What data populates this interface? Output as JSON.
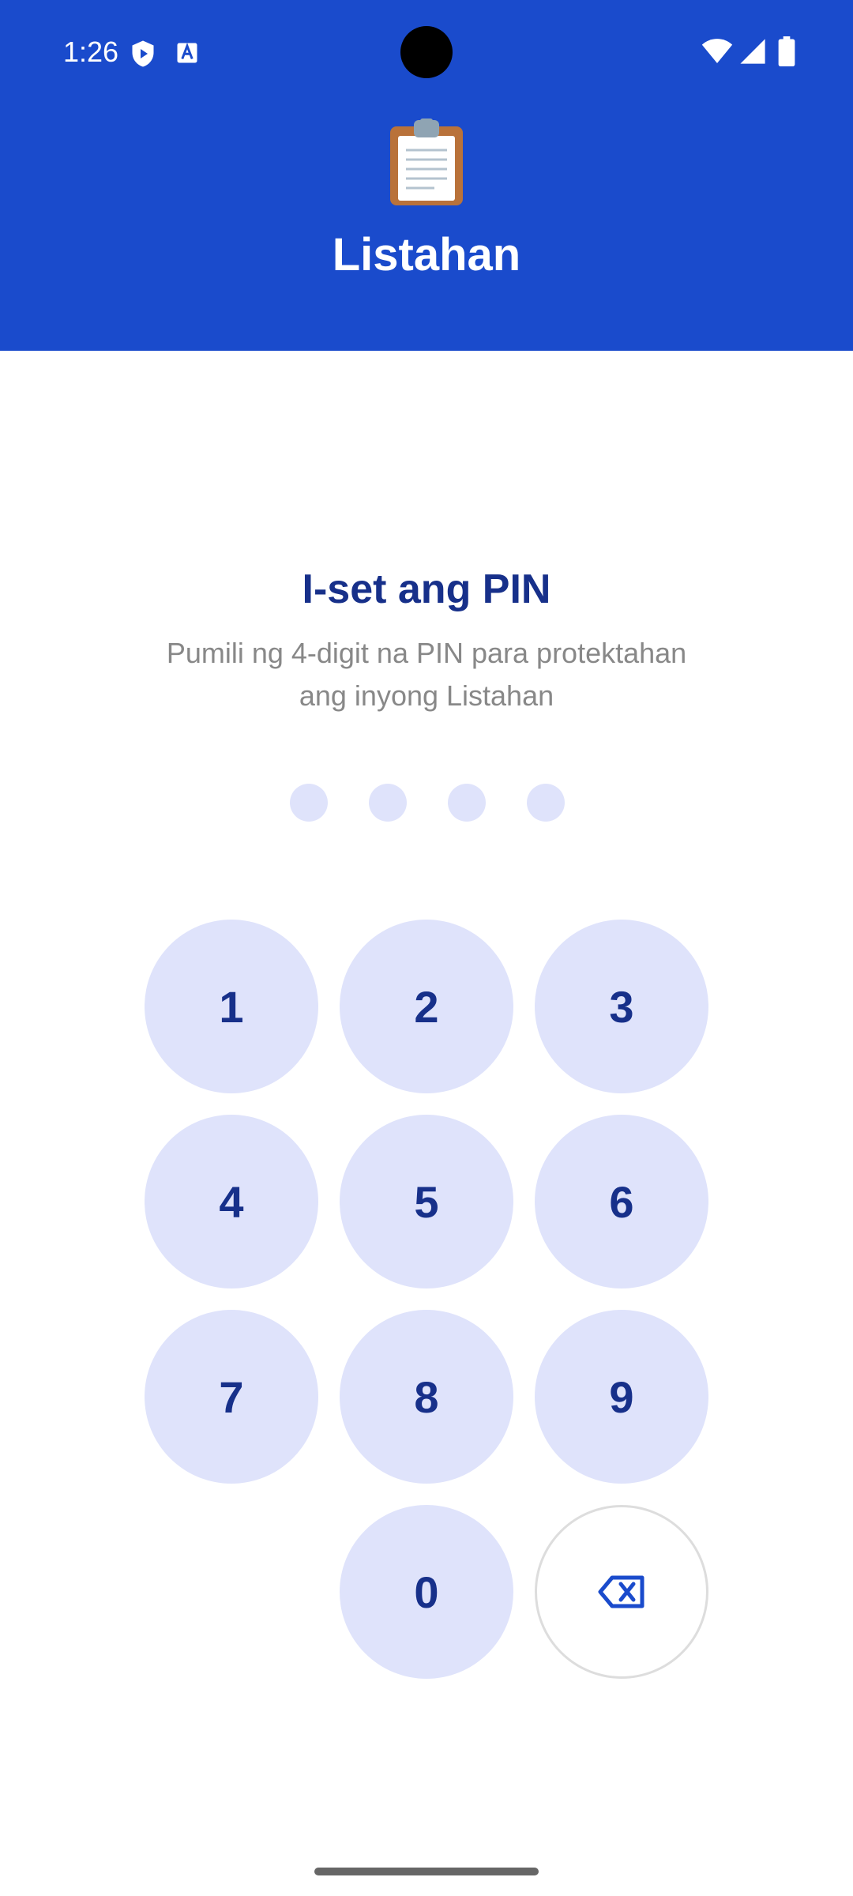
{
  "status_bar": {
    "time": "1:26",
    "icons": [
      "shield-play-icon",
      "text-a-icon",
      "camera-cutout",
      "wifi-icon",
      "cell-signal-icon",
      "battery-icon"
    ]
  },
  "header": {
    "app_icon": "clipboard-icon",
    "app_title": "Listahan",
    "background_color": "#1a4bcc"
  },
  "pin_setup": {
    "title": "I-set ang PIN",
    "subtitle": "Pumili ng 4-digit na PIN para protektahan ang inyong Listahan",
    "pin_length": 4,
    "digits_entered": 0
  },
  "keypad": {
    "keys": [
      "1",
      "2",
      "3",
      "4",
      "5",
      "6",
      "7",
      "8",
      "9",
      "0"
    ],
    "backspace_icon": "backspace-icon"
  },
  "colors": {
    "accent": "#1a4bcc",
    "title_text": "#17308a",
    "key_fill": "#dfe3fb",
    "subtitle_text": "#888888"
  }
}
